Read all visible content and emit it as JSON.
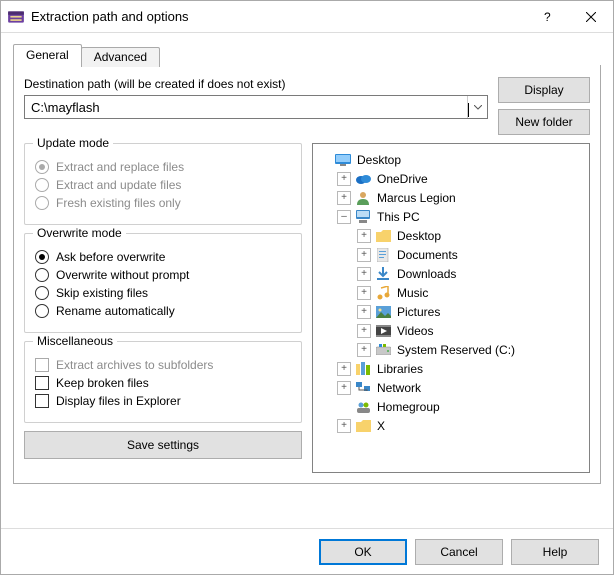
{
  "window": {
    "title": "Extraction path and options"
  },
  "tabs": {
    "general": "General",
    "advanced": "Advanced"
  },
  "dest": {
    "label": "Destination path (will be created if does not exist)",
    "value": "C:\\mayflash"
  },
  "buttons": {
    "display": "Display",
    "new_folder": "New folder",
    "save_settings": "Save settings",
    "ok": "OK",
    "cancel": "Cancel",
    "help": "Help"
  },
  "groups": {
    "update": {
      "title": "Update mode",
      "opt_replace": "Extract and replace files",
      "opt_update": "Extract and update files",
      "opt_fresh": "Fresh existing files only"
    },
    "overwrite": {
      "title": "Overwrite mode",
      "opt_ask": "Ask before overwrite",
      "opt_without": "Overwrite without prompt",
      "opt_skip": "Skip existing files",
      "opt_rename": "Rename automatically"
    },
    "misc": {
      "title": "Miscellaneous",
      "opt_subfolders": "Extract archives to subfolders",
      "opt_broken": "Keep broken files",
      "opt_explorer": "Display files in Explorer"
    }
  },
  "tree": {
    "desktop": "Desktop",
    "onedrive": "OneDrive",
    "user": "Marcus Legion",
    "thispc": "This PC",
    "pc_desktop": "Desktop",
    "pc_documents": "Documents",
    "pc_downloads": "Downloads",
    "pc_music": "Music",
    "pc_pictures": "Pictures",
    "pc_videos": "Videos",
    "pc_sysres": "System Reserved (C:)",
    "libraries": "Libraries",
    "network": "Network",
    "homegroup": "Homegroup",
    "x": "X"
  }
}
